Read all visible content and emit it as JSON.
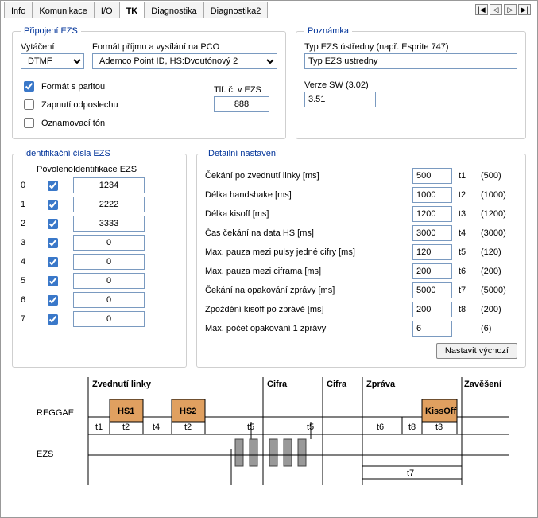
{
  "tabs": [
    "Info",
    "Komunikace",
    "I/O",
    "TK",
    "Diagnostika",
    "Diagnostika2"
  ],
  "activeTab": 3,
  "nav": {
    "first": "|◀",
    "prev": "◁",
    "next": "▷",
    "last": "▶|"
  },
  "connection": {
    "legend": "Připojení EZS",
    "dial_label": "Vytáčení",
    "dial_value": "DTMF",
    "format_label": "Formát příjmu a vysílání na PCO",
    "format_value": "Ademco Point ID, HS:Dvoutónový 2",
    "parity_label": "Formát s paritou",
    "parity": true,
    "listen_label": "Zapnutí odposlechu",
    "listen": false,
    "tone_label": "Oznamovací tón",
    "tone": false,
    "tlf_label": "Tlf. č. v EZS",
    "tlf_value": "888"
  },
  "note": {
    "legend": "Poznámka",
    "type_label": "Typ EZS ústředny (např. Esprite 747)",
    "type_value": "Typ EZS ustredny",
    "sw_label": "Verze SW (3.02)",
    "sw_value": "3.51"
  },
  "ids": {
    "legend": "Identifikační čísla EZS",
    "col_enabled": "Povoleno",
    "col_id": "Identifikace EZS",
    "rows": [
      {
        "n": "0",
        "enabled": true,
        "id": "1234"
      },
      {
        "n": "1",
        "enabled": true,
        "id": "2222"
      },
      {
        "n": "2",
        "enabled": true,
        "id": "3333"
      },
      {
        "n": "3",
        "enabled": true,
        "id": "0"
      },
      {
        "n": "4",
        "enabled": true,
        "id": "0"
      },
      {
        "n": "5",
        "enabled": true,
        "id": "0"
      },
      {
        "n": "6",
        "enabled": true,
        "id": "0"
      },
      {
        "n": "7",
        "enabled": true,
        "id": "0"
      }
    ]
  },
  "detail": {
    "legend": "Detailní nastavení",
    "rows": [
      {
        "label": "Čekání po zvednutí linky [ms]",
        "value": "500",
        "t": "t1",
        "def": "(500)"
      },
      {
        "label": "Délka handshake [ms]",
        "value": "1000",
        "t": "t2",
        "def": "(1000)"
      },
      {
        "label": "Délka kisoff [ms]",
        "value": "1200",
        "t": "t3",
        "def": "(1200)"
      },
      {
        "label": "Čas čekání na data HS [ms]",
        "value": "3000",
        "t": "t4",
        "def": "(3000)"
      },
      {
        "label": "Max. pauza mezi pulsy jedné cifry [ms]",
        "value": "120",
        "t": "t5",
        "def": "(120)"
      },
      {
        "label": "Max. pauza mezi ciframa [ms]",
        "value": "200",
        "t": "t6",
        "def": "(200)"
      },
      {
        "label": "Čekání na opakování zprávy [ms]",
        "value": "5000",
        "t": "t7",
        "def": "(5000)"
      },
      {
        "label": "Zpoždění kisoff po zprávě [ms]",
        "value": "200",
        "t": "t8",
        "def": "(200)"
      },
      {
        "label": "Max. počet opakování 1 zprávy",
        "value": "6",
        "t": "",
        "def": "(6)"
      }
    ],
    "defaults_btn": "Nastavit výchozí"
  },
  "diagram": {
    "col_labels": [
      "Zvednutí linky",
      "Cifra",
      "Cifra",
      "Zpráva",
      "Zavěšení"
    ],
    "row_reggae": "REGGAE",
    "row_ezs": "EZS",
    "hs1": "HS1",
    "hs2": "HS2",
    "kiss": "KissOff",
    "t1": "t1",
    "t2": "t2",
    "t3": "t3",
    "t4": "t4",
    "t5": "t5",
    "t6": "t6",
    "t7": "t7",
    "t8": "t8"
  }
}
